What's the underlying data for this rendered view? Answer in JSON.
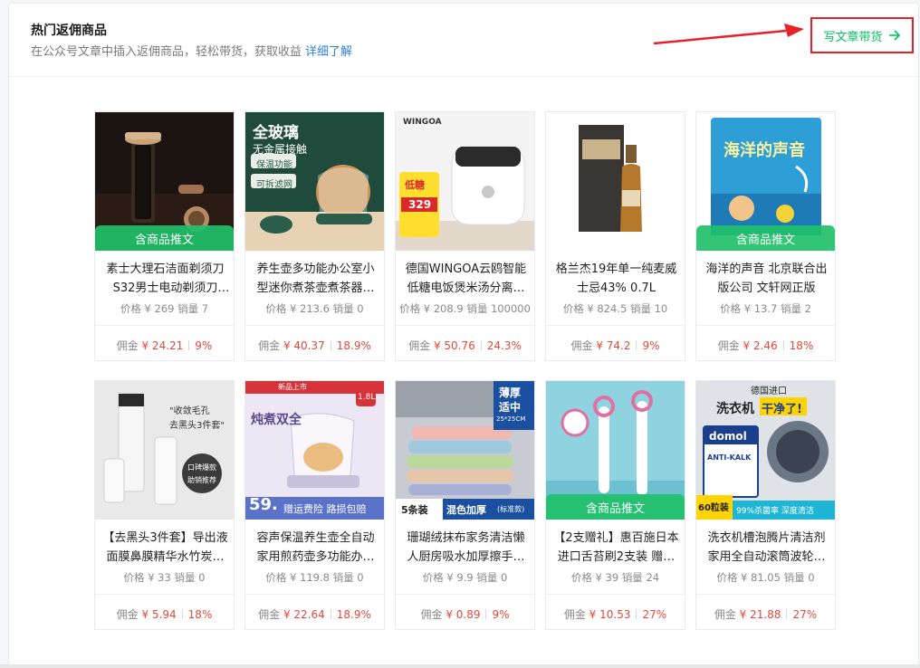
{
  "header": {
    "title": "热门返佣商品",
    "subtitle": "在公众号文章中插入返佣商品，轻松带货，获取收益",
    "learn_more": "详细了解",
    "cta_label": "写文章带货",
    "cta_icon": "arrow-right-icon"
  },
  "colors": {
    "accent": "#07c160",
    "highlight": "#e8202a",
    "price_red": "#e04a3a"
  },
  "products": [
    {
      "name": "素士大理石洁面剃须刀S32男士电动剃须刀礼…",
      "badge": "含商品推文",
      "price": "价格 ¥ 269",
      "sales": "销量 7",
      "commission_label": "佣金",
      "commission": "¥ 24.21",
      "rate": "9%"
    },
    {
      "name": "养生壶多功能办公室小型迷你煮茶壶煮茶器…",
      "badge": "",
      "price": "价格 ¥ 213.6",
      "sales": "销量 0",
      "commission_label": "佣金",
      "commission": "¥ 40.37",
      "rate": "18.9%"
    },
    {
      "name": "德国WINGOA云鸥智能低糖电饭煲米汤分离…",
      "badge": "",
      "price": "价格 ¥ 208.9",
      "sales": "销量 100000",
      "commission_label": "佣金",
      "commission": "¥ 50.76",
      "rate": "24.3%"
    },
    {
      "name": "格兰杰19年单一纯麦威士忌43% 0.7L",
      "badge": "",
      "price": "价格 ¥ 824.5",
      "sales": "销量 10",
      "commission_label": "佣金",
      "commission": "¥ 74.2",
      "rate": "9%"
    },
    {
      "name": "海洋的声音 北京联合出版公司 文轩网正版",
      "badge": "含商品推文",
      "price": "价格 ¥ 13.7",
      "sales": "销量 2",
      "commission_label": "佣金",
      "commission": "¥ 2.46",
      "rate": "18%"
    },
    {
      "name": "【去黑头3件套】导出液面膜鼻膜精华水竹炭…",
      "badge": "",
      "price": "价格 ¥ 33",
      "sales": "销量 0",
      "commission_label": "佣金",
      "commission": "¥ 5.94",
      "rate": "18%"
    },
    {
      "name": "容声保温养生壶全自动家用煎药壶多功能办…",
      "badge": "",
      "price": "价格 ¥ 119.8",
      "sales": "销量 0",
      "commission_label": "佣金",
      "commission": "¥ 22.64",
      "rate": "18.9%"
    },
    {
      "name": "珊瑚绒抹布家务清洁懒人厨房吸水加厚擦手…",
      "badge": "",
      "price": "价格 ¥ 9.9",
      "sales": "销量 0",
      "commission_label": "佣金",
      "commission": "¥ 0.89",
      "rate": "9%"
    },
    {
      "name": "【2支赠礼】惠百施日本进口舌苔刷2支装 赠…",
      "badge": "含商品推文",
      "price": "价格 ¥ 39",
      "sales": "销量 24",
      "commission_label": "佣金",
      "commission": "¥ 10.53",
      "rate": "27%"
    },
    {
      "name": "洗衣机槽泡腾片清洁剂家用全自动滚筒波轮…",
      "badge": "",
      "price": "价格 ¥ 81.05",
      "sales": "销量 0",
      "commission_label": "佣金",
      "commission": "¥ 21.88",
      "rate": "27%"
    }
  ],
  "thumb_text": {
    "p2_a": "全玻璃",
    "p2_b": "无金属接触",
    "p2_c": "保温功能",
    "p2_d": "可拆滤网",
    "p3_brand": "WINGOA",
    "p3_a": "低糖",
    "p3_b": "329",
    "p5_title": "海洋的声音",
    "p6_a": "\"收敛毛孔",
    "p6_b": "去黑头3件套\"",
    "p6_c": "口碑爆款",
    "p6_d": "助销推荐",
    "p7_a": "炖煮双全",
    "p7_b": "1.8L",
    "p7_c": "59.",
    "p7_d": "赠运费险 路损包赔",
    "p7_e": "新品上市",
    "p8_a": "薄厚",
    "p8_b": "适中",
    "p8_c": "25*25CM",
    "p8_d": "5条装",
    "p8_e": "混色加厚",
    "p8_f": "(标准款)",
    "p10_a": "德国进口",
    "p10_b": "洗衣机",
    "p10_c": "干净了!",
    "p10_d": "domol",
    "p10_e": "ANTI-KALK",
    "p10_f": "60粒装",
    "p10_g": "99%杀菌率 深度清洁"
  }
}
